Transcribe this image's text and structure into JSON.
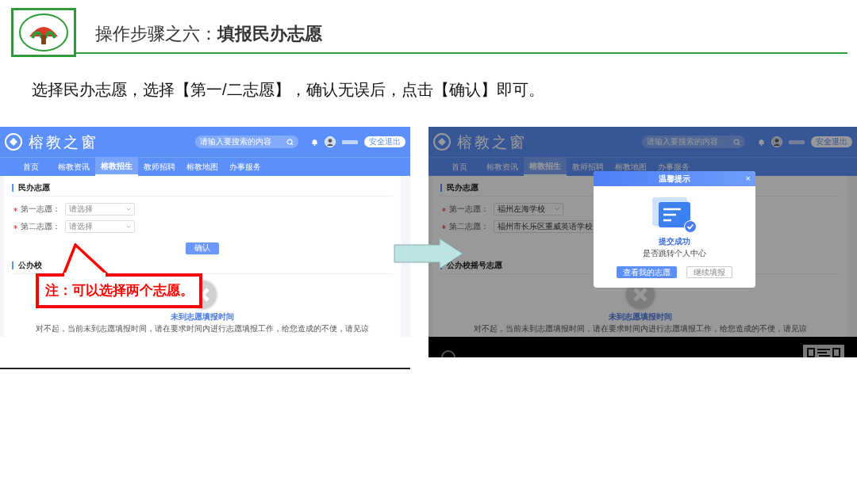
{
  "slide": {
    "title": "操作步骤之六：**填报民办志愿**",
    "instruction": "选择民办志愿，选择【第一/二志愿】，确认无误后，点击【确认】即可。"
  },
  "screenshots": [
    {
      "dimmed": false,
      "site_title": "榕教之窗",
      "search": {
        "placeholder": "请输入要搜索的内容"
      },
      "logout": "安全退出",
      "nav": [
        {
          "label": "首页",
          "selected": false
        },
        {
          "label": "榕教资讯",
          "selected": false
        },
        {
          "label": "榕教招生",
          "selected": true
        },
        {
          "label": "教师招聘",
          "selected": false
        },
        {
          "label": "榕教地图",
          "selected": false
        },
        {
          "label": "办事服务",
          "selected": false
        }
      ],
      "section_1": "民办志愿",
      "fields": [
        {
          "label": "第一志愿：",
          "required": true,
          "value": "请选择",
          "filled": false
        },
        {
          "label": "第二志愿：",
          "required": true,
          "value": "请选择",
          "filled": false
        }
      ],
      "confirm_button": "确认",
      "section_2": "公办校",
      "empty": {
        "title": "未到志愿填报时间",
        "message": "对不起，当前未到志愿填报时间，请在要求时间内进行志愿填报工作，给您造成的不便，请见谅"
      },
      "callout": "注：可以选择两个志愿。"
    },
    {
      "dimmed": true,
      "site_title": "榕教之窗",
      "search": {
        "placeholder": "请输入要搜索的内容"
      },
      "logout": "安全退出",
      "nav": [
        {
          "label": "首页",
          "selected": false
        },
        {
          "label": "榕教资讯",
          "selected": false
        },
        {
          "label": "榕教招生",
          "selected": true
        },
        {
          "label": "教师招聘",
          "selected": false
        },
        {
          "label": "榕教地图",
          "selected": false
        },
        {
          "label": "办事服务",
          "selected": false
        }
      ],
      "section_1": "民办志愿",
      "fields": [
        {
          "label": "第一志愿：",
          "required": true,
          "value": "福州左海学校",
          "filled": true
        },
        {
          "label": "第二志愿：",
          "required": true,
          "value": "福州市长乐区重威英语学校",
          "filled": true
        }
      ],
      "section_2": "公办校摇号志愿",
      "empty": {
        "title": "未到志愿填报时间",
        "message": "对不起，当前未到志愿填报时间，请在要求时间内进行志愿填报工作，给您造成的不便，请见谅"
      },
      "footer": true,
      "modal": {
        "title": "温馨提示",
        "close": "×",
        "heading": "提交成功",
        "text": "是否跳转个人中心",
        "buttons": [
          {
            "label": "查看我的志愿",
            "primary": true
          },
          {
            "label": "继续填报",
            "primary": false
          }
        ]
      }
    }
  ]
}
